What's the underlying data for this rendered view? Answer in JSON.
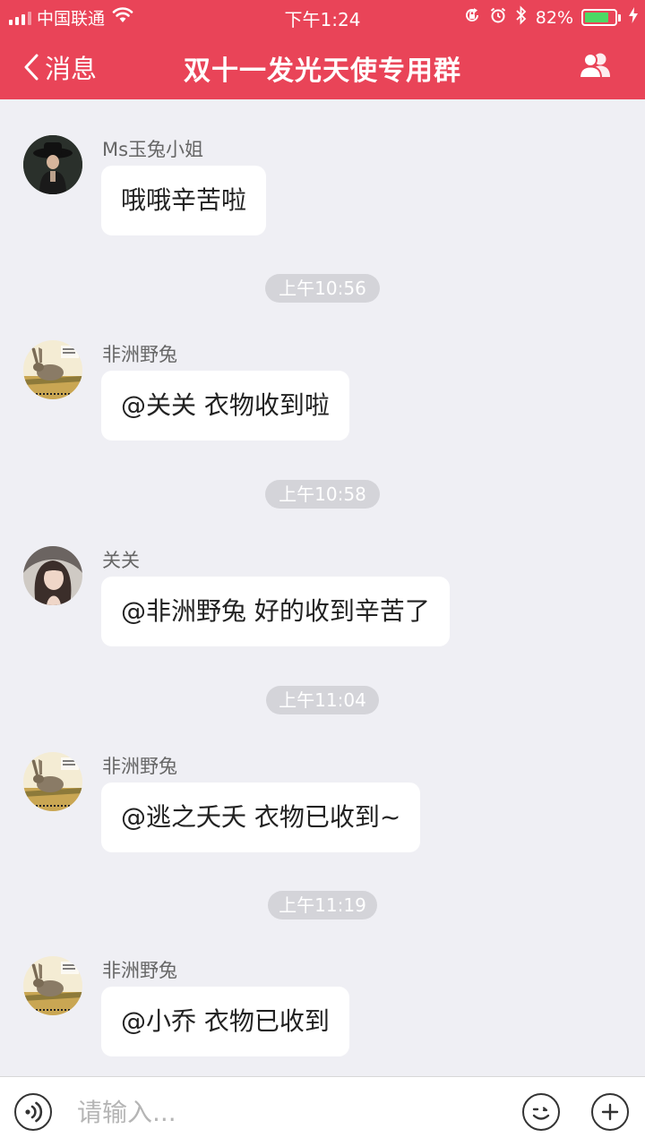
{
  "status_bar": {
    "carrier": "中国联通",
    "time": "下午1:24",
    "battery_percent": "82%",
    "battery_level": 0.82
  },
  "nav": {
    "back_label": "消息",
    "title": "双十一发光天使专用群"
  },
  "messages": [
    {
      "sender": "Ms玉兔小姐",
      "text": "哦哦辛苦啦",
      "avatar": "woman-hat-avatar"
    },
    {
      "timestamp": "上午10:56"
    },
    {
      "sender": "非洲野兔",
      "text": "@关关  衣物收到啦",
      "avatar": "hare-avatar"
    },
    {
      "timestamp": "上午10:58"
    },
    {
      "sender": "关关",
      "text": "@非洲野兔  好的收到辛苦了",
      "avatar": "woman-veil-avatar"
    },
    {
      "timestamp": "上午11:04"
    },
    {
      "sender": "非洲野兔",
      "text": "@逃之夭夭  衣物已收到~",
      "avatar": "hare-avatar"
    },
    {
      "timestamp": "上午11:19"
    },
    {
      "sender": "非洲野兔",
      "text": "@小乔  衣物已收到",
      "avatar": "hare-avatar"
    }
  ],
  "input": {
    "placeholder": "请输入..."
  },
  "colors": {
    "brand": "#e94458",
    "background": "#efeff4",
    "bubble": "#ffffff",
    "timestamp_pill": "#d4d4d9",
    "battery_fill": "#4cd964"
  }
}
